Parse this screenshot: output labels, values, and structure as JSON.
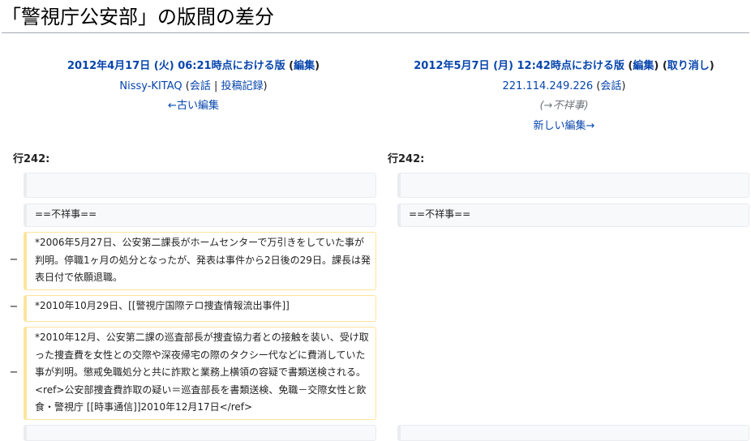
{
  "page": {
    "title": "「警視庁公安部」の版間の差分"
  },
  "left": {
    "ts_link": "2012年4月17日 (火) 06:21時点における版",
    "edit_open": " (",
    "edit_link": "編集",
    "edit_close": ")",
    "user_link": "Nissy-KITAQ",
    "user_paren_open": " (",
    "talk_link": "会話",
    "sep": " | ",
    "contribs_link": "投稿記録",
    "user_paren_close": ")",
    "older_link": "←古い編集"
  },
  "right": {
    "ts_link": "2012年5月7日 (月) 12:42時点における版",
    "edit_open": " (",
    "edit_link": "編集",
    "edit_close": ") ",
    "undo_open": "(",
    "undo_link": "取り消し",
    "undo_close": ")",
    "ip_link": "221.114.249.226",
    "user_paren_open": " (",
    "talk_link": "会話",
    "user_paren_close": ")",
    "comment_open": "(",
    "comment_link": "→不祥事",
    "comment_close": ")",
    "newer_link": "新しい編集→"
  },
  "diff": {
    "left_lineno": "行242:",
    "right_lineno": "行242:",
    "minus": "−",
    "ctx_blank": "",
    "ctx_heading": "==不祥事==",
    "deleted_1": "*2006年5月27日、公安第二課長がホームセンターで万引きをしていた事が判明。停職1ヶ月の処分となったが、発表は事件から2日後の29日。課長は発表日付で依願退職。",
    "deleted_2": "*2010年10月29日、[[警視庁国際テロ捜査情報流出事件]]",
    "deleted_3": "*2010年12月、公安第二課の巡査部長が捜査協力者との接触を装い、受け取った捜査費を女性との交際や深夜帰宅の際のタクシー代などに費消していた事が判明。懲戒免職処分と共に詐欺と業務上横領の容疑で書類送検される。<ref>公安部捜査費詐取の疑い＝巡査部長を書類送検、免職－交際女性と飲食・警視庁 [[時事通信]]2010年12月17日</ref>"
  },
  "colors": {
    "link": "#0645ad",
    "context_bg": "#f8f9fa",
    "context_border": "#eaecf0",
    "deleted_border": "#ffe49c"
  }
}
